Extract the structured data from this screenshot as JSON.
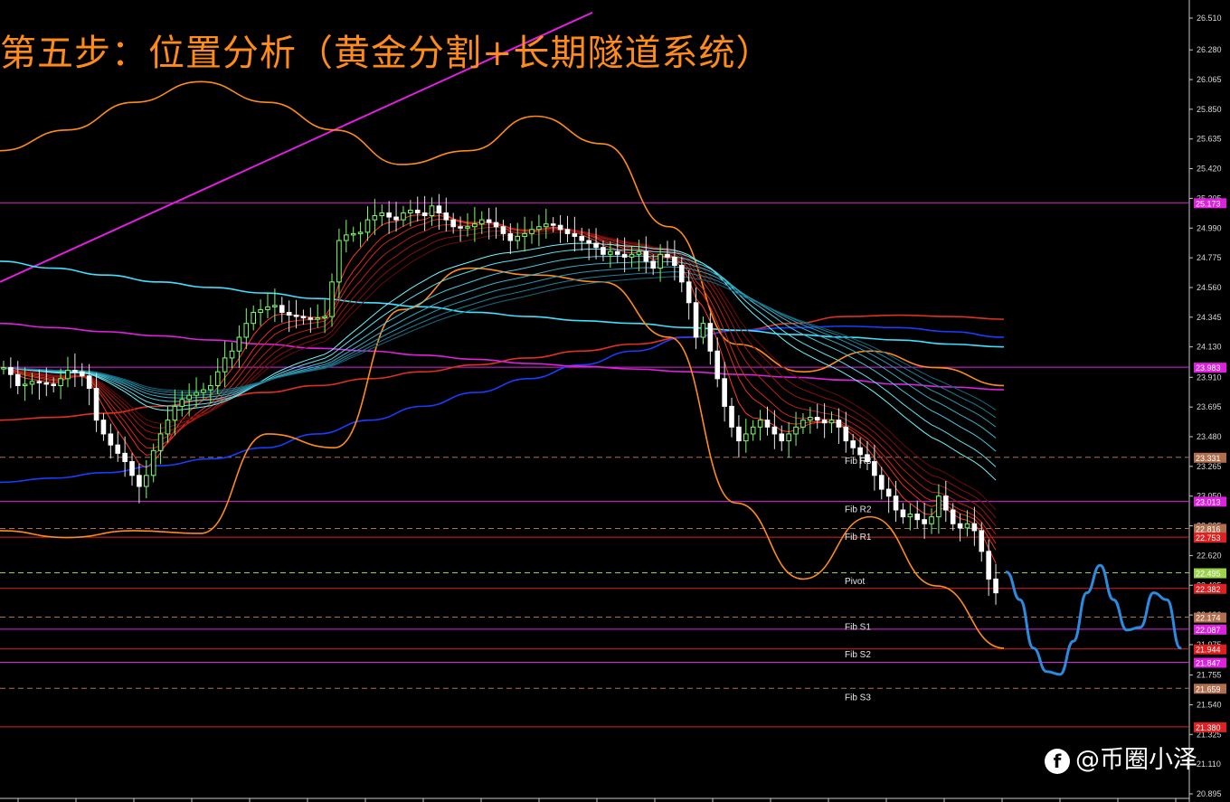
{
  "title": "第五步：位置分析（黄金分割+长期隧道系统）",
  "watermark": {
    "logo_icon": "f-icon",
    "text": "@币圈小泽"
  },
  "chart_data": {
    "type": "candlestick",
    "title": "第五步：位置分析（黄金分割+长期隧道系统）",
    "ylim": [
      20.895,
      26.51
    ],
    "price_ticks": [
      "26.510",
      "26.280",
      "26.065",
      "25.850",
      "25.635",
      "25.420",
      "25.205",
      "24.990",
      "24.775",
      "24.560",
      "24.345",
      "24.130",
      "23.910",
      "23.695",
      "23.480",
      "23.265",
      "23.050",
      "22.835",
      "22.620",
      "22.405",
      "22.190",
      "21.975",
      "21.755",
      "21.540",
      "21.325",
      "21.110",
      "20.895"
    ],
    "level_lines": [
      {
        "price": 25.173,
        "label": "25.173",
        "color": "#e020e0",
        "style": "solid"
      },
      {
        "price": 23.983,
        "label": "23.983",
        "color": "#e020e0",
        "style": "solid"
      },
      {
        "price": 23.331,
        "label": "23.331",
        "color": "#b07050",
        "style": "dash"
      },
      {
        "price": 23.013,
        "label": "23.013",
        "color": "#e020e0",
        "style": "solid"
      },
      {
        "price": 22.816,
        "label": "22.816",
        "color": "#b07050",
        "style": "dash"
      },
      {
        "price": 22.753,
        "label": "22.753",
        "color": "#e02020",
        "style": "solid"
      },
      {
        "price": 22.495,
        "label": "22.495",
        "color": "#9ad24a",
        "style": "dash"
      },
      {
        "price": 22.382,
        "label": "22.382",
        "color": "#e02020",
        "style": "solid"
      },
      {
        "price": 22.174,
        "label": "22.174",
        "color": "#b07050",
        "style": "dash"
      },
      {
        "price": 22.087,
        "label": "22.087",
        "color": "#e020e0",
        "style": "solid"
      },
      {
        "price": 21.944,
        "label": "21.944",
        "color": "#e02020",
        "style": "solid"
      },
      {
        "price": 21.847,
        "label": "21.847",
        "color": "#e020e0",
        "style": "solid"
      },
      {
        "price": 21.659,
        "label": "21.659",
        "color": "#b07050",
        "style": "dash"
      },
      {
        "price": 21.38,
        "label": "21.380",
        "color": "#e02020",
        "style": "solid"
      }
    ],
    "pivot_labels": [
      {
        "text": "Fib R3",
        "price": 23.31
      },
      {
        "text": "Fib R2",
        "price": 22.96
      },
      {
        "text": "Fib R1",
        "price": 22.76
      },
      {
        "text": "Pivot",
        "price": 22.44
      },
      {
        "text": "Fib S1",
        "price": 22.11
      },
      {
        "text": "Fib S2",
        "price": 21.91
      },
      {
        "text": "Fib S3",
        "price": 21.6
      }
    ],
    "bars": 140,
    "x_last": 140,
    "closes": [
      23.98,
      23.93,
      23.85,
      23.86,
      23.88,
      23.87,
      23.86,
      23.85,
      23.9,
      23.96,
      23.95,
      23.92,
      23.83,
      23.6,
      23.5,
      23.42,
      23.36,
      23.3,
      23.2,
      23.12,
      23.2,
      23.38,
      23.5,
      23.6,
      23.7,
      23.75,
      23.78,
      23.8,
      23.82,
      23.85,
      23.95,
      24.05,
      24.1,
      24.2,
      24.3,
      24.38,
      24.4,
      24.42,
      24.43,
      24.38,
      24.36,
      24.35,
      24.34,
      24.33,
      24.34,
      24.35,
      24.6,
      24.9,
      24.94,
      24.95,
      24.96,
      25.05,
      25.08,
      25.1,
      25.07,
      25.05,
      25.1,
      25.12,
      25.1,
      25.08,
      25.15,
      25.1,
      25.05,
      25.0,
      24.99,
      25.0,
      25.02,
      25.05,
      25.03,
      25.0,
      24.95,
      24.9,
      24.93,
      24.95,
      24.98,
      25.0,
      25.02,
      25.01,
      24.98,
      24.95,
      24.93,
      24.9,
      24.88,
      24.85,
      24.8,
      24.82,
      24.8,
      24.78,
      24.8,
      24.82,
      24.75,
      24.7,
      24.8,
      24.78,
      24.72,
      24.6,
      24.45,
      24.2,
      24.3,
      24.1,
      23.9,
      23.7,
      23.55,
      23.45,
      23.5,
      23.55,
      23.6,
      23.55,
      23.5,
      23.45,
      23.5,
      23.55,
      23.6,
      23.62,
      23.6,
      23.58,
      23.6,
      23.55,
      23.45,
      23.4,
      23.35,
      23.3,
      23.2,
      23.1,
      23.05,
      22.95,
      22.9,
      22.92,
      22.88,
      22.85,
      22.9,
      23.05,
      22.95,
      22.85,
      22.82,
      22.85,
      22.8,
      22.65,
      22.45,
      22.35
    ],
    "moving_averages": [
      {
        "name": "",
        "color": "#e03020",
        "values": [
          23.6,
          23.62,
          23.65,
          23.7,
          23.75,
          23.8,
          23.85,
          23.9,
          23.95,
          24.0,
          24.05,
          24.1,
          24.15,
          24.2,
          24.25,
          24.3,
          24.35,
          24.36,
          24.35,
          24.33
        ]
      },
      {
        "name": "",
        "color": "#1a3cff",
        "values": [
          23.15,
          23.18,
          23.22,
          23.27,
          23.32,
          23.4,
          23.5,
          23.6,
          23.7,
          23.8,
          23.9,
          24.0,
          24.1,
          24.2,
          24.25,
          24.27,
          24.28,
          24.27,
          24.24,
          24.2
        ]
      },
      {
        "name": "",
        "color": "#40e0ff",
        "values": [
          24.75,
          24.7,
          24.65,
          24.6,
          24.56,
          24.52,
          24.48,
          24.45,
          24.42,
          24.38,
          24.35,
          24.32,
          24.3,
          24.27,
          24.25,
          24.22,
          24.2,
          24.18,
          24.15,
          24.13
        ]
      },
      {
        "name": "",
        "color": "#e020e0",
        "values": [
          24.3,
          24.27,
          24.24,
          24.21,
          24.18,
          24.15,
          24.12,
          24.1,
          24.07,
          24.04,
          24.01,
          23.99,
          23.97,
          23.95,
          23.93,
          23.91,
          23.89,
          23.86,
          23.84,
          23.82
        ]
      },
      {
        "name": "",
        "color": "#ff8c1a",
        "values": [
          25.55,
          25.7,
          25.9,
          26.05,
          25.9,
          25.7,
          25.45,
          25.55,
          25.8,
          25.6,
          25.0,
          24.15,
          23.95,
          24.1,
          23.98,
          23.85
        ]
      },
      {
        "name": "",
        "color": "#ff8c1a",
        "values": [
          22.8,
          22.75,
          22.8,
          22.78,
          23.5,
          23.4,
          24.4,
          24.7,
          24.65,
          24.6,
          24.2,
          23.0,
          22.45,
          22.9,
          22.4,
          21.95
        ]
      }
    ],
    "trendline": {
      "color": "#e020e0",
      "from_price": 24.6,
      "to_price": 26.55
    },
    "projection": {
      "color": "#2a8be0",
      "values": [
        22.5,
        22.3,
        21.95,
        21.78,
        21.76,
        22.0,
        22.35,
        22.55,
        22.3,
        22.08,
        22.1,
        22.35,
        22.3,
        21.95
      ]
    },
    "grid": false
  }
}
